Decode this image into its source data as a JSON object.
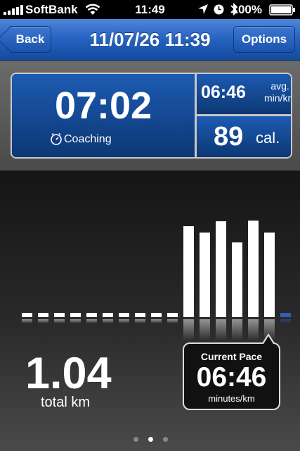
{
  "status": {
    "carrier": "SoftBank",
    "time": "11:49",
    "battery": "100%"
  },
  "nav": {
    "back_label": "Back",
    "title": "11/07/26 11:39",
    "options_label": "Options"
  },
  "summary": {
    "duration": "07:02",
    "coaching_label": "Coaching",
    "avg_pace": "06:46",
    "pace_unit_line1": "avg.",
    "pace_unit_line2": "min/km",
    "calories": "89",
    "calories_unit": "cal."
  },
  "distance": {
    "value": "1.04",
    "label": "total km"
  },
  "current_pace": {
    "title": "Current Pace",
    "value": "06:46",
    "unit": "minutes/km"
  },
  "pace_graph": {
    "bar_heights_fraction": [
      0.04,
      0.04,
      0.04,
      0.04,
      0.04,
      0.04,
      0.04,
      0.04,
      0.04,
      0.04,
      0.92,
      0.86,
      0.97,
      0.76,
      0.98,
      0.86,
      0.04
    ],
    "highlight_color": "#2f5fb8",
    "bar_color": "#ffffff"
  },
  "page_indicator": {
    "count": 3,
    "active_index": 1
  }
}
